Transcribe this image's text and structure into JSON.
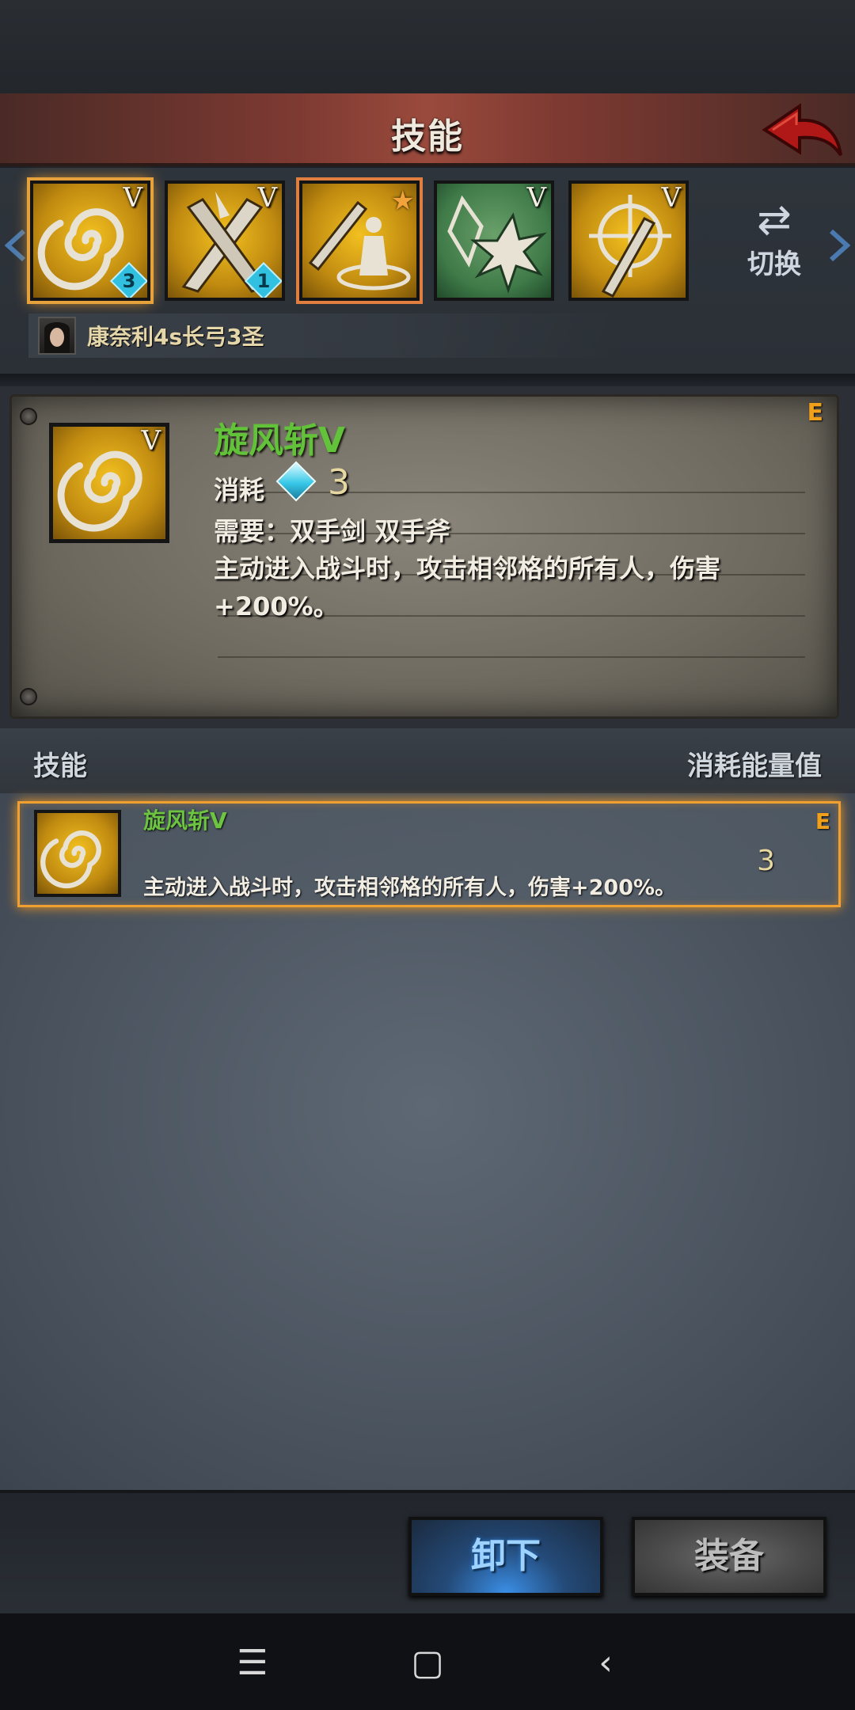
{
  "header": {
    "title": "技能"
  },
  "slots": [
    {
      "name": "whirlwind",
      "grade": "V",
      "level": "3",
      "color": "gold",
      "selected": true
    },
    {
      "name": "cross-blade",
      "grade": "V",
      "level": "1",
      "color": "gold"
    },
    {
      "name": "shield-sword",
      "grade": "",
      "star": "★",
      "color": "gold",
      "highlight": true
    },
    {
      "name": "crystal-burst",
      "grade": "V",
      "color": "green"
    },
    {
      "name": "target-strike",
      "grade": "V",
      "color": "gold"
    }
  ],
  "switch": {
    "label": "切换",
    "icon": "⇄"
  },
  "hero": {
    "name": "康奈利4s长弓3圣"
  },
  "detail": {
    "name": "旋风斩V",
    "grade": "V",
    "rarity": "E",
    "cost_label": "消耗",
    "cost_value": "3",
    "requirement": "需要：双手剑  双手斧",
    "description": "主动进入战斗时，攻击相邻格的所有人，伤害+200%。"
  },
  "list_header": {
    "left": "技能",
    "right": "消耗能量值"
  },
  "list": [
    {
      "name": "旋风斩V",
      "rarity": "E",
      "description": "主动进入战斗时，攻击相邻格的所有人，伤害+200%。",
      "cost": "3"
    }
  ],
  "buttons": {
    "unequip": "卸下",
    "equip": "装备"
  },
  "nav": {
    "menu": "☰",
    "home": "▢",
    "back": "‹"
  },
  "colors": {
    "skill_name": "#62c23a",
    "rarity": "#f0a01a",
    "selection": "#f0a030"
  }
}
